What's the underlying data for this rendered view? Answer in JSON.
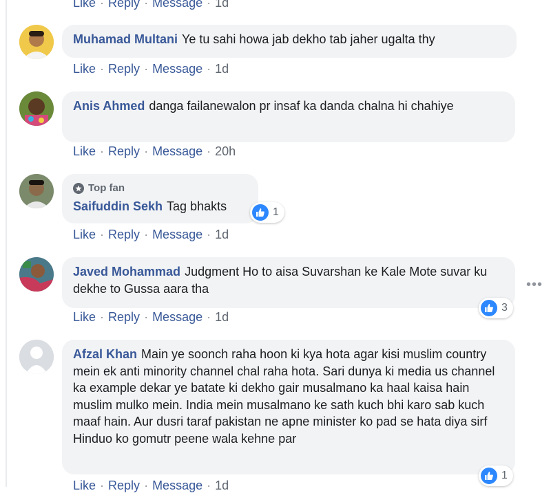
{
  "actions": {
    "like": "Like",
    "reply": "Reply",
    "message": "Message",
    "sep": "·"
  },
  "top_partial": {
    "time": "1d"
  },
  "comments": [
    {
      "name": "Muhamad Multani",
      "text": "Ye tu sahi howa jab dekho tab jaher ugalta thy",
      "time": "1d"
    },
    {
      "name": "Anis Ahmed",
      "text": "danga failanewalon pr insaf ka danda chalna hi chahiye",
      "time": "20h"
    },
    {
      "badge": "Top fan",
      "name": "Saifuddin Sekh",
      "text": "Tag bhakts",
      "time": "1d",
      "reactions": "1"
    },
    {
      "name": "Javed Mohammad",
      "text": "Judgment Ho to aisa Suvarshan ke Kale Mote suvar ku dekhe to Gussa aara tha",
      "time": "1d",
      "reactions": "3"
    },
    {
      "name": "Afzal Khan",
      "text": "Main ye soonch raha hoon ki kya hota agar kisi muslim country mein ek anti minority channel chal raha hota. Sari dunya ki media us channel ka example dekar ye batate ki dekho gair musalmano ka haal kaisa hain muslim mulko mein. India mein musalmano ke sath kuch bhi karo sab kuch maaf hain. Aur dusri taraf pakistan ne apne minister ko pad se hata diya sirf Hinduo ko gomutr peene wala kehne par",
      "time": "1d",
      "reactions": "1"
    }
  ],
  "colors": {
    "link": "#385898",
    "bubble": "#f2f3f5",
    "meta": "#606770",
    "like_blue": "#2d88ff"
  },
  "icons": {
    "like": "thumbs-up-icon",
    "top_fan": "star-badge-icon",
    "more": "more-options-icon"
  }
}
